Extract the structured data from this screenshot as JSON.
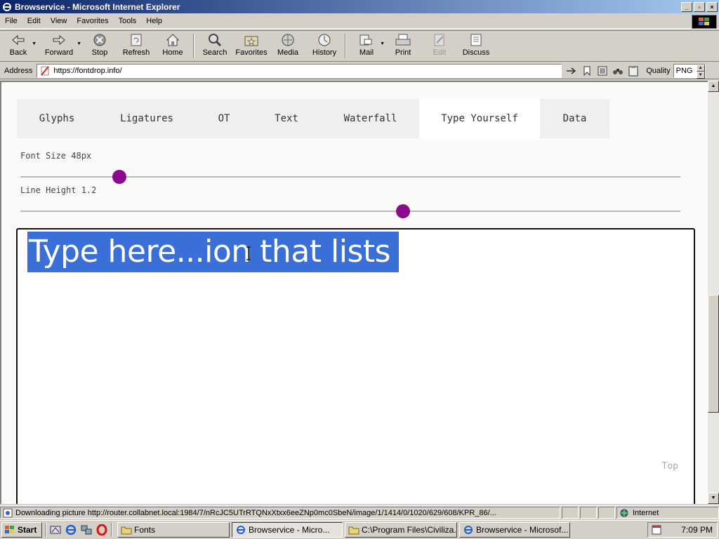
{
  "window": {
    "title": "Browservice - Microsoft Internet Explorer",
    "controls": [
      "minimize",
      "maximize",
      "close"
    ]
  },
  "menu": [
    "File",
    "Edit",
    "View",
    "Favorites",
    "Tools",
    "Help"
  ],
  "toolbar": {
    "back": "Back",
    "forward": "Forward",
    "stop": "Stop",
    "refresh": "Refresh",
    "home": "Home",
    "search": "Search",
    "favorites": "Favorites",
    "media": "Media",
    "history": "History",
    "mail": "Mail",
    "print": "Print",
    "edit": "Edit",
    "discuss": "Discuss"
  },
  "address": {
    "label": "Address",
    "url": "https://fontdrop.info/",
    "quality_label": "Quality",
    "quality_value": "PNG"
  },
  "page": {
    "tabs": [
      "Glyphs",
      "Ligatures",
      "OT",
      "Text",
      "Waterfall",
      "Type Yourself",
      "Data"
    ],
    "active_tab": "Type Yourself",
    "font_size_label": "Font Size 48px",
    "font_size_level": 0.15,
    "line_height_label": "Line Height 1.2",
    "line_height_level": 0.58,
    "editor_text": "Type here...ion that lists",
    "top_link": "Top",
    "selection_color": "#3a6fd8",
    "accent_color": "#8c0a8c"
  },
  "statusbar": {
    "message": "Downloading picture http://router.collabnet.local:1984/7/nRcJC5UTrRTQNxXtxx6eeZNp0mc0SbeN/image/1/1414/0/1020/629/608/KPR_86/...",
    "zone": "Internet"
  },
  "taskbar": {
    "start": "Start",
    "tasks": [
      {
        "label": "Fonts",
        "icon": "folder-icon"
      },
      {
        "label": "Browservice - Micro...",
        "icon": "ie-icon",
        "active": true
      },
      {
        "label": "C:\\Program Files\\Civiliza...",
        "icon": "folder-icon"
      },
      {
        "label": "Browservice - Microsof...",
        "icon": "ie-icon"
      }
    ],
    "clock": "7:09 PM"
  }
}
